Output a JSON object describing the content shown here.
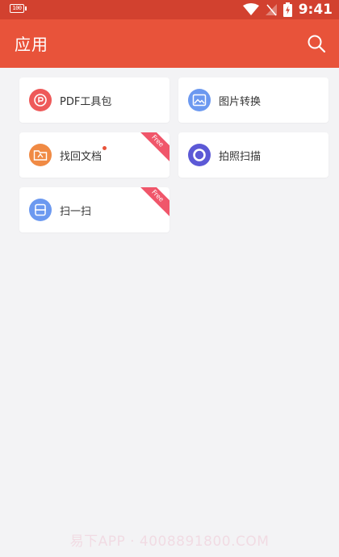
{
  "status_bar": {
    "battery_left_text": "100",
    "battery_right_text": "Z",
    "time": "9:41"
  },
  "app_bar": {
    "title": "应用"
  },
  "cards": [
    {
      "label": "PDF工具包",
      "icon": "pdf-toolkit-icon",
      "color": "#ee5a5a",
      "badge": "",
      "ribbon": ""
    },
    {
      "label": "图片转换",
      "icon": "image-convert-icon",
      "color": "#6c99f0",
      "badge": "",
      "ribbon": ""
    },
    {
      "label": "找回文档",
      "icon": "recover-document-icon",
      "color": "#f08a44",
      "badge": "red-dot",
      "ribbon": "Free"
    },
    {
      "label": "拍照扫描",
      "icon": "camera-scan-icon",
      "color": "#5c59d6",
      "badge": "",
      "ribbon": ""
    },
    {
      "label": "扫一扫",
      "icon": "scan-icon",
      "color": "#6c99f0",
      "badge": "",
      "ribbon": "Free"
    }
  ],
  "watermark": "易下APP · 4008891800.COM"
}
